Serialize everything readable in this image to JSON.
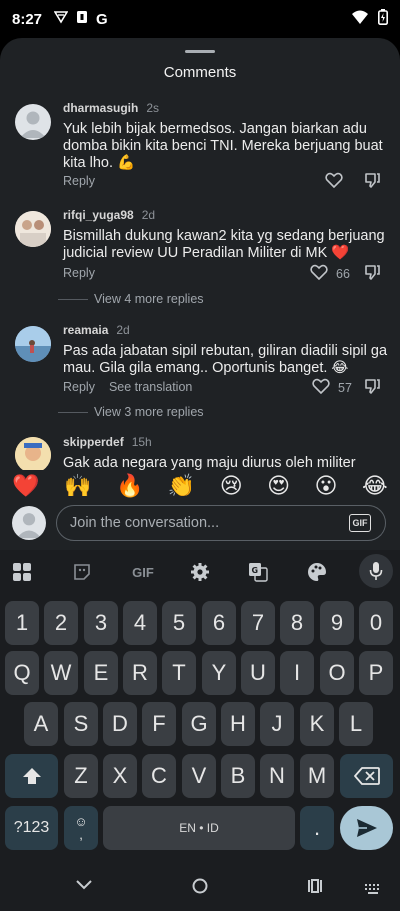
{
  "status_bar": {
    "time": "8:27"
  },
  "sheet": {
    "title": "Comments"
  },
  "comments": [
    {
      "username": "dharmasugih",
      "timestamp": "2s",
      "text": "Yuk lebih bijak bermedsos. Jangan biarkan adu domba bikin kita benci TNI. Mereka berjuang buat kita lho. 💪",
      "reply": "Reply"
    },
    {
      "username": "rifqi_yuga98",
      "timestamp": "2d",
      "text": "Bismillah dukung kawan2 kita yg sedang berjuang judicial review UU Peradilan Militer di MK ❤️",
      "reply": "Reply",
      "likes": "66",
      "more_replies": "View 4 more replies"
    },
    {
      "username": "reamaia",
      "timestamp": "2d",
      "text": "Pas ada jabatan sipil rebutan, giliran diadili sipil ga mau. Gila gila emang.. Oportunis banget. 😂",
      "reply": "Reply",
      "see_translation": "See translation",
      "likes": "57",
      "more_replies": "View 3 more replies"
    },
    {
      "username": "skipperdef",
      "timestamp": "15h",
      "text": "Gak ada negara yang maju diurus oleh militer"
    }
  ],
  "emoji_bar": [
    "❤️",
    "🙌",
    "🔥",
    "👏",
    "😢",
    "😍",
    "😮",
    "😂"
  ],
  "input": {
    "placeholder": "Join the conversation...",
    "gif_label": "GIF"
  },
  "keyboard": {
    "toolbar_gif": "GIF",
    "row_numbers": [
      "1",
      "2",
      "3",
      "4",
      "5",
      "6",
      "7",
      "8",
      "9",
      "0"
    ],
    "row1": [
      "Q",
      "W",
      "E",
      "R",
      "T",
      "Y",
      "U",
      "I",
      "O",
      "P"
    ],
    "row2": [
      "A",
      "S",
      "D",
      "F",
      "G",
      "H",
      "J",
      "K",
      "L"
    ],
    "row3": [
      "Z",
      "X",
      "C",
      "V",
      "B",
      "N",
      "M"
    ],
    "symbols_key": "?123",
    "emoji_key": "☺",
    "comma_key": ",",
    "space_label": "EN • ID",
    "period_key": "."
  },
  "colors": {
    "sheet_bg": "#1f2225",
    "keyboard_bg": "#1b1d20",
    "key_bg": "#3a3e43",
    "enter_bg": "#a9c7d6"
  }
}
